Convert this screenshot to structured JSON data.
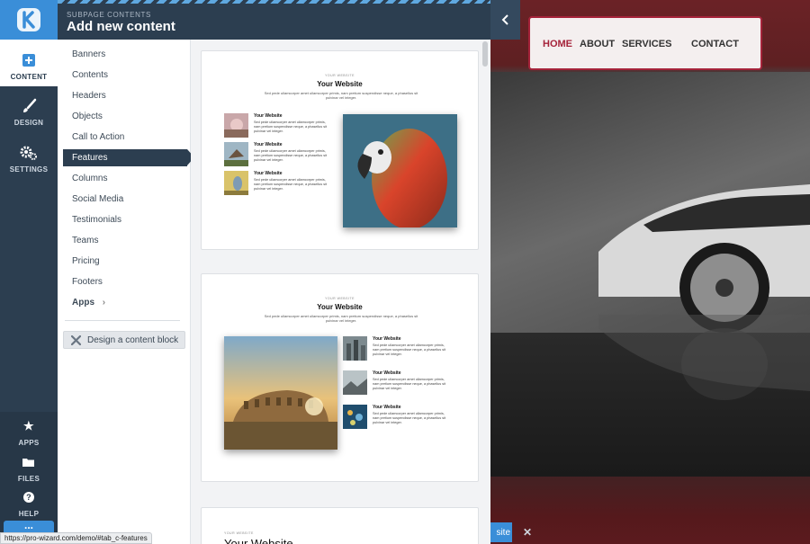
{
  "header": {
    "subtitle": "SUBPAGE CONTENTS",
    "title": "Add new content"
  },
  "rail": {
    "content": "CONTENT",
    "design": "DESIGN",
    "settings": "SETTINGS",
    "apps": "APPS",
    "files": "FILES",
    "help": "HELP",
    "more": "..."
  },
  "menu": {
    "items": [
      "Banners",
      "Contents",
      "Headers",
      "Objects",
      "Call to Action",
      "Features",
      "Columns",
      "Social Media",
      "Testimonials",
      "Teams",
      "Pricing",
      "Footers"
    ],
    "active": "Features",
    "apps": "Apps",
    "design_button": "Design a content block"
  },
  "preview": {
    "kicker": "YOUR WEBSITE",
    "heading": "Your Website",
    "lead": "Sed pede ullamcorper amet ullamcorper primis, nam pretium suspendisse neque, a phasellus sit pulvinar vel integer.",
    "feature_title": "Your Website",
    "feature_text": "Sed pede ullamcorper amet ullamcorper primis, nam pretium suspendisse neque, a phasellus sit pulvinar vel integer."
  },
  "site": {
    "nav": [
      "HOME",
      "ABOUT",
      "SERVICES",
      "CONTACT"
    ],
    "button_fragment": "site",
    "close": "✕"
  },
  "status_url": "https://pro-wizard.com/demo/#tab_c-features",
  "colors": {
    "sidebar": "#2c3e50",
    "accent": "#3a8ed8",
    "brand_red": "#a5233a"
  }
}
